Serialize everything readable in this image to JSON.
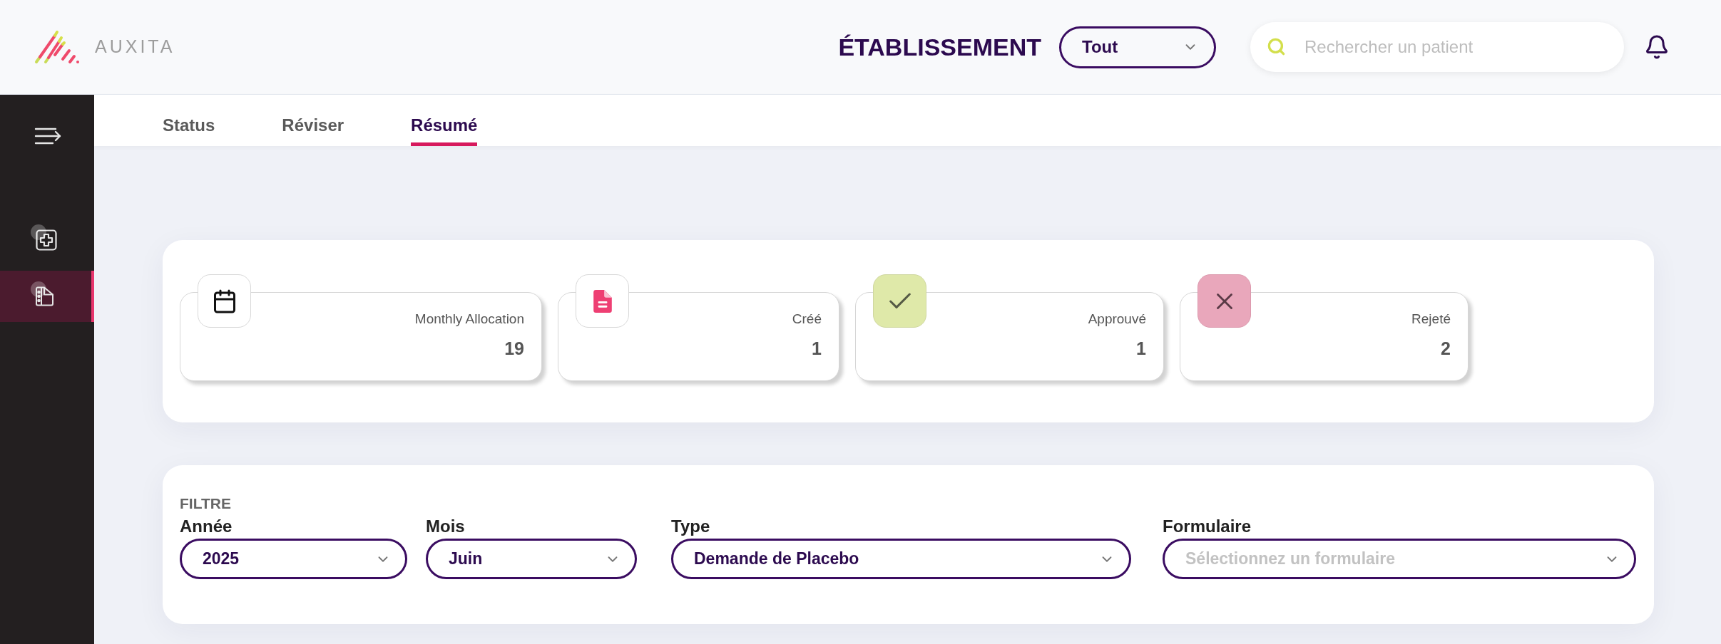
{
  "header": {
    "logo_text": "AUXITA",
    "establishment_label": "ÉTABLISSEMENT",
    "establishment_select": {
      "value": "Tout"
    },
    "search": {
      "placeholder": "Rechercher un patient"
    }
  },
  "sidebar": {
    "items": [
      {
        "kind": "add",
        "selected": false
      },
      {
        "kind": "document",
        "selected": true
      }
    ]
  },
  "tabs": [
    {
      "label": "Status",
      "selected": false
    },
    {
      "label": "Réviser",
      "selected": false
    },
    {
      "label": "Résumé",
      "selected": true
    }
  ],
  "stats": [
    {
      "kind": "allocation",
      "label": "Monthly Allocation",
      "value": "19"
    },
    {
      "kind": "created",
      "label": "Créé",
      "value": "1"
    },
    {
      "kind": "approved",
      "label": "Approuvé",
      "value": "1"
    },
    {
      "kind": "rejected",
      "label": "Rejeté",
      "value": "2"
    }
  ],
  "filter": {
    "title": "FILTRE",
    "fields": [
      {
        "label": "Année",
        "value": "2025"
      },
      {
        "label": "Mois",
        "value": "Juin"
      },
      {
        "label": "Type",
        "value": "Demande de Placebo"
      },
      {
        "label": "Formulaire",
        "placeholder": "Sélectionnez un formulaire"
      }
    ]
  }
}
